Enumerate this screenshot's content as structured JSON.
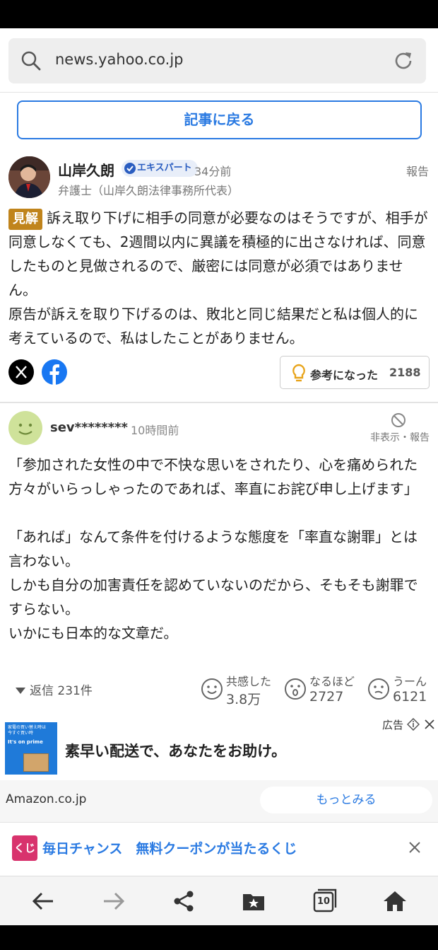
{
  "browser": {
    "url": "news.yahoo.co.jp",
    "tab_count": "10"
  },
  "back_to_article": "記事に戻る",
  "expert_comment": {
    "name": "山岸久朗",
    "badge": "エキスパート",
    "time": "34分前",
    "report": "報告",
    "title": "弁護士（山岸久朗法律事務所代表）",
    "tag": "見解",
    "body": "訴え取り下げに相手の同意が必要なのはそうですが、相手が同意しなくても、2週間以内に異議を積極的に出さなければ、同意したものと見做されるので、厳密には同意が必須ではありません。\n原告が訴えを取り下げるのは、敗北と同じ結果だと私は個人的に考えているので、私はしたことがありません。",
    "helpful_label": "参考になった",
    "helpful_count": "2188"
  },
  "user_comment": {
    "user": "sev********",
    "time": "10時間前",
    "hide_report": "非表示・報告",
    "body": "「参加された女性の中で不快な思いをされたり、心を痛められた方々がいらっしゃったのであれば、率直にお詫び申し上げます」\n\n「あれば」なんて条件を付けるような態度を「率直な謝罪」とは言わない。\nしかも自分の加害責任を認めていないのだから、そもそも謝罪ですらない。\nいかにも日本的な文章だ。",
    "replies": "返信 231件",
    "reactions": [
      {
        "label": "共感した",
        "count": "3.8万",
        "icon": "smile-face-icon"
      },
      {
        "label": "なるほど",
        "count": "2727",
        "icon": "surprised-face-icon"
      },
      {
        "label": "うーん",
        "count": "6121",
        "icon": "thinking-face-icon"
      }
    ]
  },
  "ad": {
    "label": "広告",
    "image_text_1": "家電の買い替え時は\n今すぐ買い時",
    "image_text_2": "It's on prime",
    "text": "素早い配送で、あなたをお助け。",
    "source": "Amazon.co.jp",
    "more": "もっとみる"
  },
  "banner": {
    "icon_text": "くじ",
    "text": "毎日チャンス　無料クーポンが当たるくじ"
  },
  "colors": {
    "accent": "#2a7ae2",
    "tag": "#c0841c",
    "facebook": "#1877f2"
  }
}
